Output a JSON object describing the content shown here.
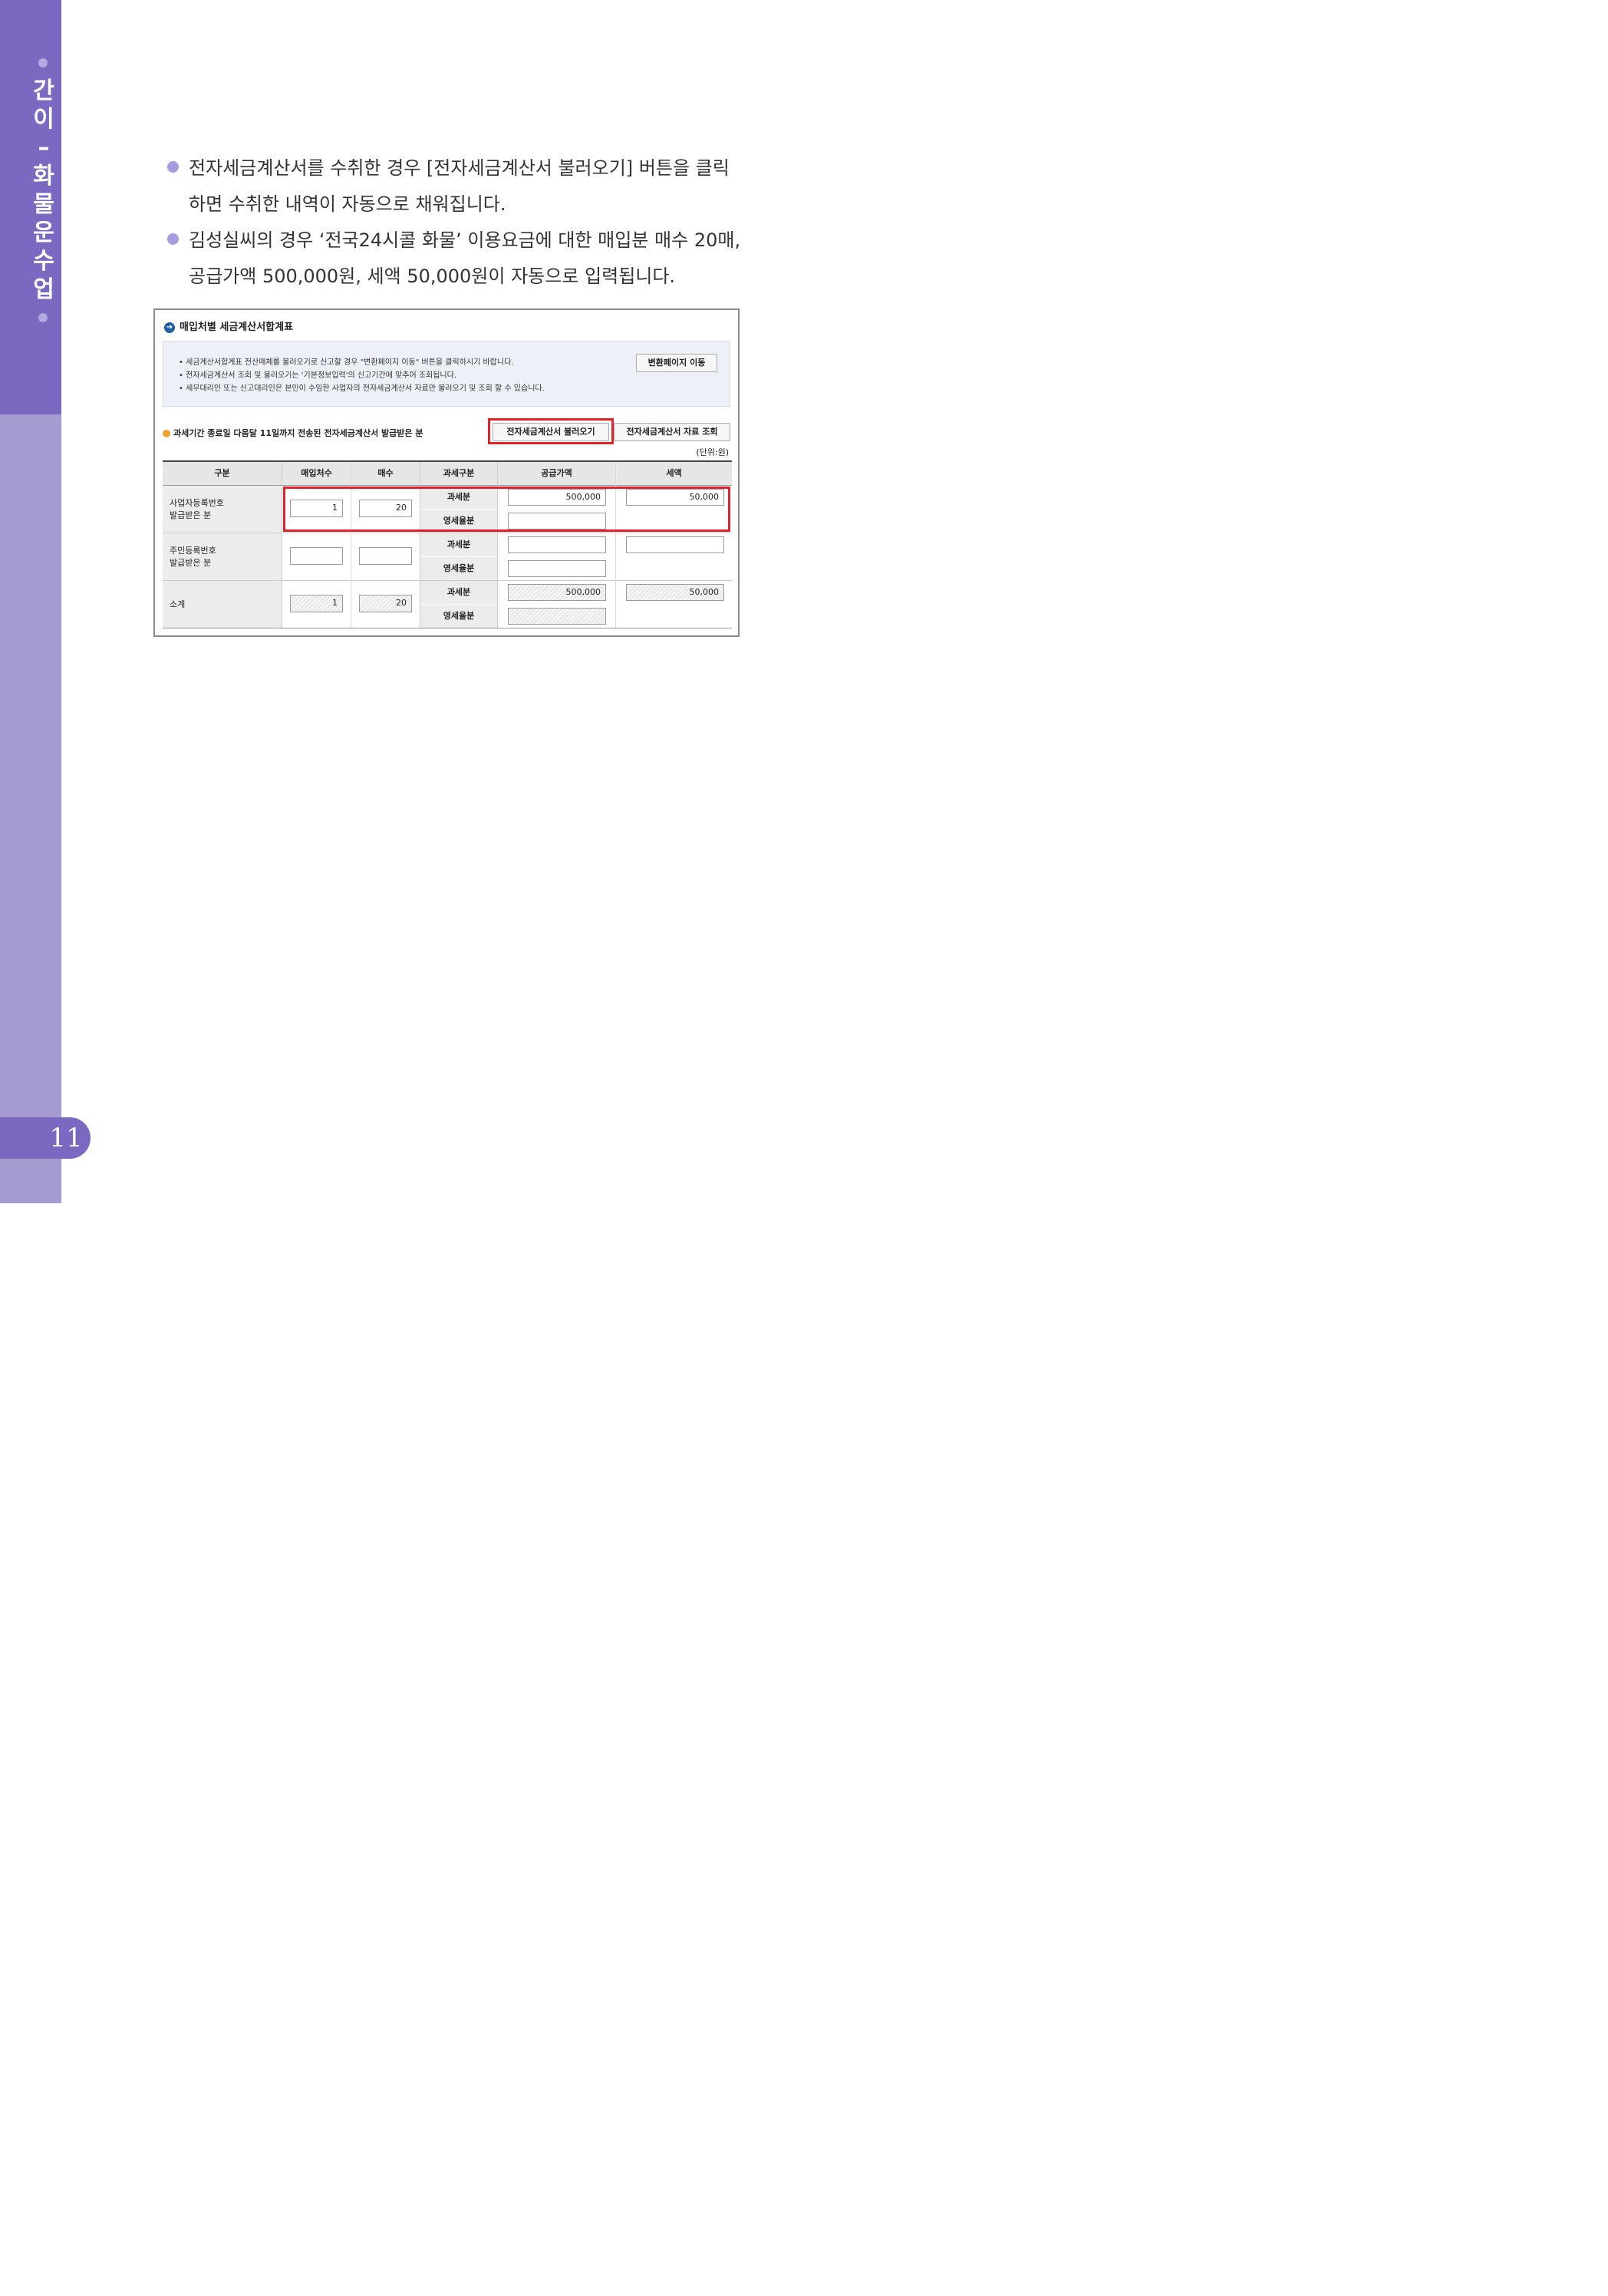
{
  "sidebar": {
    "chapter_chars": [
      "간",
      "이",
      "–",
      "화",
      "물",
      "운",
      "수",
      "업"
    ],
    "page_number": "11"
  },
  "bullets": [
    {
      "lines": [
        "전자세금계산서를 수취한 경우 [전자세금계산서 불러오기] 버튼을 클릭",
        "하면 수취한 내역이 자동으로 채워집니다."
      ]
    },
    {
      "lines": [
        "김성실씨의 경우 ‘전국24시콜 화물’ 이용요금에 대한 매입분 매수 20매,",
        "공급가액 500,000원, 세액 50,000원이 자동으로 입력됩니다."
      ]
    }
  ],
  "figure": {
    "title": "매입처별 세금계산서합계표",
    "notices": [
      "• 세금계산서합계표 전산매체를 불러오기로 신고할 경우 \"변환페이지 이동\" 버튼을 클릭하시기 바랍니다.",
      "• 전자세금계산서 조회 및 불러오기는 '기본정보입력'의 신고기간에 맞추어 조회됩니다.",
      "• 세무대리인 또는 신고대리인은 본인이 수임한 사업자의 전자세금계산서 자료만 불러오기 및 조회 할 수 있습니다."
    ],
    "convert_button": "변환페이지 이동",
    "section_label": "과세기간 종료일 다음달 11일까지 전송된 전자세금계산서 발급받은 분",
    "load_button": "전자세금계산서 불러오기",
    "query_button": "전자세금계산서 자료 조회",
    "unit": "(단위:원)",
    "headers": [
      "구분",
      "매입처수",
      "매수",
      "과세구분",
      "공급가액",
      "세액"
    ],
    "rows": [
      {
        "label_1": "사업자등록번호",
        "label_2": "발급받은 분",
        "vendors": "1",
        "count": "20",
        "taxable": "과세분",
        "zero": "영세율분",
        "supply_taxable": "500,000",
        "tax_taxable": "50,000",
        "supply_zero": ""
      },
      {
        "label_1": "주민등록번호",
        "label_2": "발급받은 분",
        "vendors": "",
        "count": "",
        "taxable": "과세분",
        "zero": "영세율분",
        "supply_taxable": "",
        "tax_taxable": "",
        "supply_zero": ""
      },
      {
        "label_1": "소계",
        "label_2": "",
        "vendors": "1",
        "count": "20",
        "taxable": "과세분",
        "zero": "영세율분",
        "supply_taxable": "500,000",
        "tax_taxable": "50,000",
        "supply_zero": ""
      }
    ]
  },
  "colors": {
    "sidebar_dark": "#7b68c1",
    "sidebar_light": "#a59bd1",
    "bullet_dot": "#a79be0",
    "highlight_red": "#e0202a"
  }
}
